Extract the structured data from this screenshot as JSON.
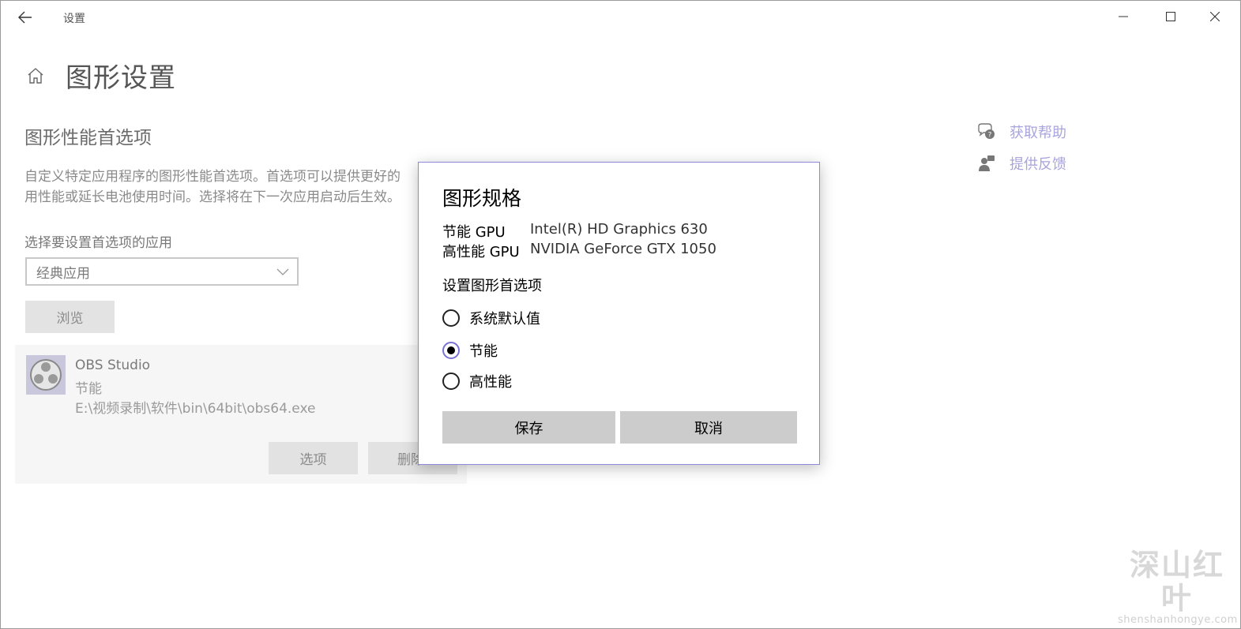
{
  "window": {
    "title": "设置"
  },
  "page": {
    "title": "图形设置",
    "section_title": "图形性能首选项",
    "description_line1": "自定义特定应用程序的图形性能首选项。首选项可以提供更好的",
    "description_line2": "用性能或延长电池使用时间。选择将在下一次应用启动后生效。",
    "select_label": "选择要设置首选项的应用",
    "select_value": "经典应用",
    "browse_label": "浏览"
  },
  "app_card": {
    "name": "OBS Studio",
    "mode": "节能",
    "path": "E:\\视频录制\\软件\\bin\\64bit\\obs64.exe",
    "options_label": "选项",
    "delete_label": "删除"
  },
  "help": {
    "get_help": "获取帮助",
    "feedback": "提供反馈"
  },
  "dialog": {
    "title": "图形规格",
    "specs": [
      {
        "key": "节能 GPU",
        "value": "Intel(R) HD Graphics 630"
      },
      {
        "key": "高性能 GPU",
        "value": "NVIDIA GeForce GTX 1050"
      }
    ],
    "pref_label": "设置图形首选项",
    "options": [
      {
        "label": "系统默认值",
        "checked": false
      },
      {
        "label": "节能",
        "checked": true
      },
      {
        "label": "高性能",
        "checked": false
      }
    ],
    "save_label": "保存",
    "cancel_label": "取消"
  },
  "watermark": {
    "text": "深山红叶",
    "url": "shenshanhongye.com"
  },
  "colors": {
    "accent": "#7a73d6",
    "link": "#a8a4df",
    "button": "#cccccc"
  }
}
